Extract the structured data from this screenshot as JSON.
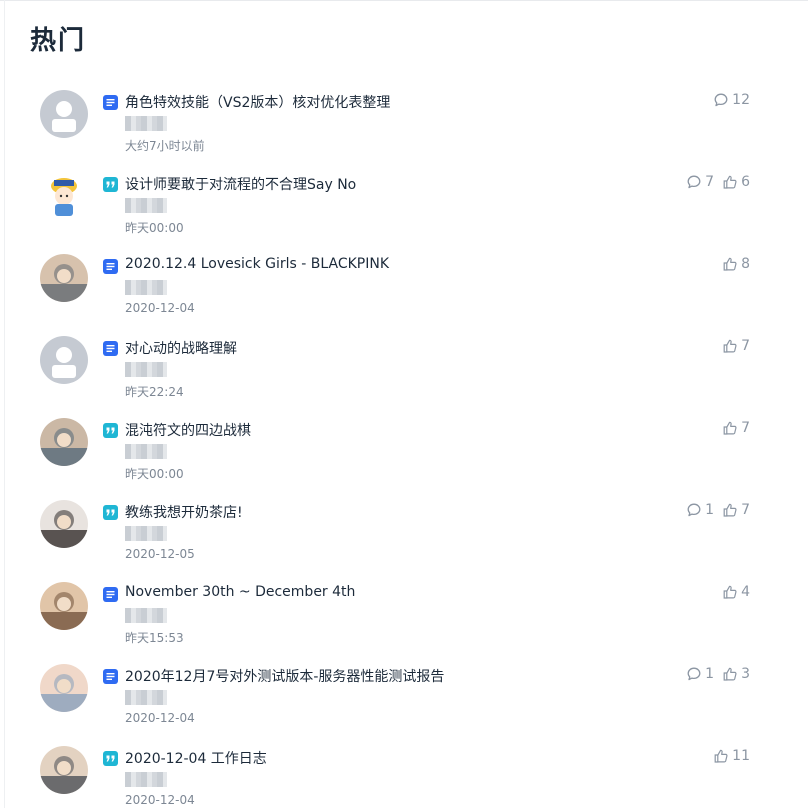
{
  "section_title": "热门",
  "items": [
    {
      "title": "角色特效技能（VS2版本）核对优化表整理",
      "type": "doc",
      "time": "大约7小时以前",
      "comments": "12",
      "likes": null,
      "avatar": "placeholder"
    },
    {
      "title": "设计师要敢于对流程的不合理Say No",
      "type": "quote",
      "time": "昨天00:00",
      "comments": "7",
      "likes": "6",
      "avatar": "cartoon"
    },
    {
      "title": "2020.12.4 Lovesick Girls - BLACKPINK",
      "type": "doc",
      "time": "2020-12-04",
      "comments": null,
      "likes": "8",
      "avatar": "photo"
    },
    {
      "title": "对心动的战略理解",
      "type": "doc",
      "time": "昨天22:24",
      "comments": null,
      "likes": "7",
      "avatar": "placeholder"
    },
    {
      "title": "混沌符文的四边战棋",
      "type": "quote",
      "time": "昨天00:00",
      "comments": null,
      "likes": "7",
      "avatar": "photo"
    },
    {
      "title": "教练我想开奶茶店!",
      "type": "quote",
      "time": "2020-12-05",
      "comments": "1",
      "likes": "7",
      "avatar": "photo"
    },
    {
      "title": "November 30th ~ December 4th",
      "type": "doc",
      "time": "昨天15:53",
      "comments": null,
      "likes": "4",
      "avatar": "photo"
    },
    {
      "title": "2020年12月7号对外测试版本-服务器性能测试报告",
      "type": "doc",
      "time": "2020-12-04",
      "comments": "1",
      "likes": "3",
      "avatar": "photo"
    },
    {
      "title": "2020-12-04 工作日志",
      "type": "quote",
      "time": "2020-12-04",
      "comments": null,
      "likes": "11",
      "avatar": "photo"
    }
  ],
  "colors": {
    "doc_icon": "#2f6bf2",
    "quote_icon": "#1fb6d4",
    "placeholder_avatar": "#c5cad2"
  }
}
